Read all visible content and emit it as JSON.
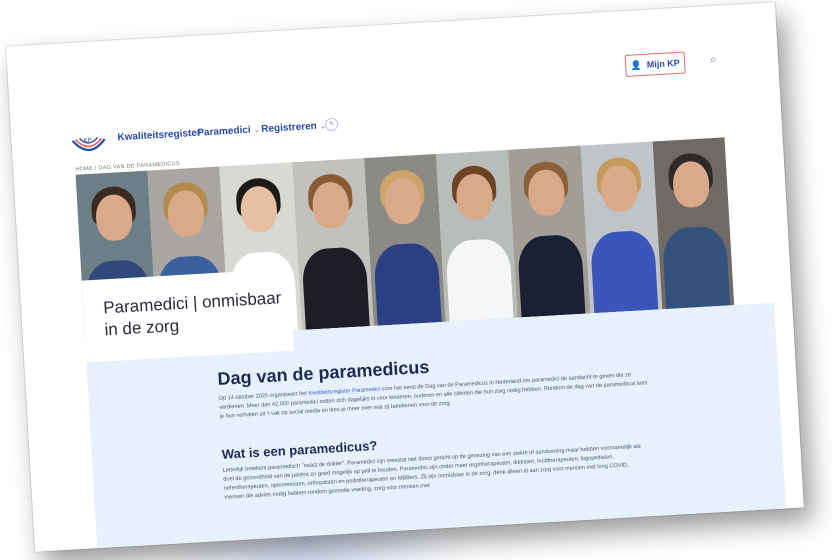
{
  "header": {
    "brand": "Kwaliteitsregister",
    "nav": [
      {
        "label": "Paramedici",
        "chevron": "⌄"
      },
      {
        "label": "Registreren",
        "chevron": "⌄"
      }
    ],
    "account_label": "Mijn KP",
    "icons": [
      "logo-kp",
      "edit-icon",
      "user-icon",
      "search-icon"
    ]
  },
  "breadcrumb": "HOME / DAG VAN DE PARAMEDICUS",
  "hero": {
    "title": "Paramedici | onmisbaar in de zorg",
    "people_count": 9
  },
  "article": {
    "heading": "Dag van de paramedicus",
    "intro_before_link": "Op 14 oktober 2025 organiseert het ",
    "intro_link": "Kwaliteitsregister Paramedici",
    "intro_after_link": " voor het eerst de Dag van de Paramedicus in Nederland om paramedici de aandacht te geven die ze verdienen. Meer dan 42.000 paramedici zetten zich dagelijks in voor kinderen, ouderen en alle cliënten die hun zorg nodig hebben. Rondom de dag van de paramedicus lees je hun verhalen uit 't vak op social media en lees je meer over wat zij betekenen voor de zorg.",
    "subheading": "Wat is een paramedicus?",
    "body": "Letterlijk betekent paramedisch \"naast de dokter\". Paramedici zijn meestal niet direct gericht op de genezing van een ziekte of aandoening maar hebben voornamelijk als doel de gezondheid van de patiënt zo goed mogelijk op peil te houden. Paramedici zijn onder meer ergotherapeuten, diëtisten, huidtherapeuten, logopedisten, oefentherapeuten, optometristen, orthoptisten en podotherapeuten en MBBers. Zij zijn onmisbaar in de zorg, denk alleen al aan zorg voor mensen met long COVID, mensen die advies nodig hebben rondom gezonde voeding, zorg voor mensen met"
  },
  "colors": {
    "brand_blue": "#2a49a8",
    "accent_red": "#e06b6b",
    "content_bg": "#e6f1fb"
  }
}
